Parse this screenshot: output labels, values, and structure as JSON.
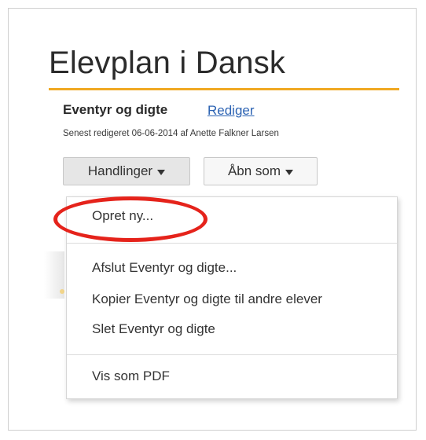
{
  "page": {
    "title": "Elevplan i Dansk",
    "accent_color": "#f0a823"
  },
  "document": {
    "title": "Eventyr og digte",
    "edit_link": "Rediger",
    "meta": "Senest redigeret 06-06-2014 af Anette Falkner Larsen"
  },
  "toolbar": {
    "actions_label": "Handlinger",
    "open_as_label": "Åbn som"
  },
  "menu": {
    "items": [
      {
        "label": "Opret ny..."
      },
      {
        "label": "Afslut Eventyr og digte..."
      },
      {
        "label": "Kopier Eventyr og digte til andre elever"
      },
      {
        "label": "Slet Eventyr og digte"
      },
      {
        "label": "Vis som PDF"
      }
    ]
  },
  "annotation": {
    "ring_color": "#e5231b"
  }
}
